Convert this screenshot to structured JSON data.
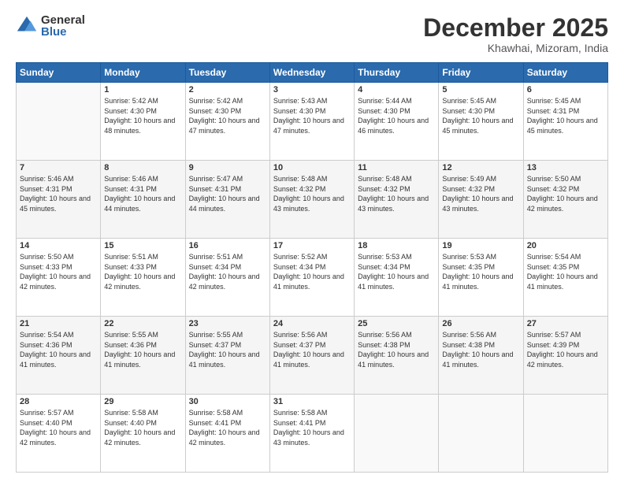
{
  "logo": {
    "general": "General",
    "blue": "Blue"
  },
  "header": {
    "month": "December 2025",
    "location": "Khawhai, Mizoram, India"
  },
  "weekdays": [
    "Sunday",
    "Monday",
    "Tuesday",
    "Wednesday",
    "Thursday",
    "Friday",
    "Saturday"
  ],
  "weeks": [
    [
      {
        "day": "",
        "sunrise": "",
        "sunset": "",
        "daylight": ""
      },
      {
        "day": "1",
        "sunrise": "Sunrise: 5:42 AM",
        "sunset": "Sunset: 4:30 PM",
        "daylight": "Daylight: 10 hours and 48 minutes."
      },
      {
        "day": "2",
        "sunrise": "Sunrise: 5:42 AM",
        "sunset": "Sunset: 4:30 PM",
        "daylight": "Daylight: 10 hours and 47 minutes."
      },
      {
        "day": "3",
        "sunrise": "Sunrise: 5:43 AM",
        "sunset": "Sunset: 4:30 PM",
        "daylight": "Daylight: 10 hours and 47 minutes."
      },
      {
        "day": "4",
        "sunrise": "Sunrise: 5:44 AM",
        "sunset": "Sunset: 4:30 PM",
        "daylight": "Daylight: 10 hours and 46 minutes."
      },
      {
        "day": "5",
        "sunrise": "Sunrise: 5:45 AM",
        "sunset": "Sunset: 4:30 PM",
        "daylight": "Daylight: 10 hours and 45 minutes."
      },
      {
        "day": "6",
        "sunrise": "Sunrise: 5:45 AM",
        "sunset": "Sunset: 4:31 PM",
        "daylight": "Daylight: 10 hours and 45 minutes."
      }
    ],
    [
      {
        "day": "7",
        "sunrise": "Sunrise: 5:46 AM",
        "sunset": "Sunset: 4:31 PM",
        "daylight": "Daylight: 10 hours and 45 minutes."
      },
      {
        "day": "8",
        "sunrise": "Sunrise: 5:46 AM",
        "sunset": "Sunset: 4:31 PM",
        "daylight": "Daylight: 10 hours and 44 minutes."
      },
      {
        "day": "9",
        "sunrise": "Sunrise: 5:47 AM",
        "sunset": "Sunset: 4:31 PM",
        "daylight": "Daylight: 10 hours and 44 minutes."
      },
      {
        "day": "10",
        "sunrise": "Sunrise: 5:48 AM",
        "sunset": "Sunset: 4:32 PM",
        "daylight": "Daylight: 10 hours and 43 minutes."
      },
      {
        "day": "11",
        "sunrise": "Sunrise: 5:48 AM",
        "sunset": "Sunset: 4:32 PM",
        "daylight": "Daylight: 10 hours and 43 minutes."
      },
      {
        "day": "12",
        "sunrise": "Sunrise: 5:49 AM",
        "sunset": "Sunset: 4:32 PM",
        "daylight": "Daylight: 10 hours and 43 minutes."
      },
      {
        "day": "13",
        "sunrise": "Sunrise: 5:50 AM",
        "sunset": "Sunset: 4:32 PM",
        "daylight": "Daylight: 10 hours and 42 minutes."
      }
    ],
    [
      {
        "day": "14",
        "sunrise": "Sunrise: 5:50 AM",
        "sunset": "Sunset: 4:33 PM",
        "daylight": "Daylight: 10 hours and 42 minutes."
      },
      {
        "day": "15",
        "sunrise": "Sunrise: 5:51 AM",
        "sunset": "Sunset: 4:33 PM",
        "daylight": "Daylight: 10 hours and 42 minutes."
      },
      {
        "day": "16",
        "sunrise": "Sunrise: 5:51 AM",
        "sunset": "Sunset: 4:34 PM",
        "daylight": "Daylight: 10 hours and 42 minutes."
      },
      {
        "day": "17",
        "sunrise": "Sunrise: 5:52 AM",
        "sunset": "Sunset: 4:34 PM",
        "daylight": "Daylight: 10 hours and 41 minutes."
      },
      {
        "day": "18",
        "sunrise": "Sunrise: 5:53 AM",
        "sunset": "Sunset: 4:34 PM",
        "daylight": "Daylight: 10 hours and 41 minutes."
      },
      {
        "day": "19",
        "sunrise": "Sunrise: 5:53 AM",
        "sunset": "Sunset: 4:35 PM",
        "daylight": "Daylight: 10 hours and 41 minutes."
      },
      {
        "day": "20",
        "sunrise": "Sunrise: 5:54 AM",
        "sunset": "Sunset: 4:35 PM",
        "daylight": "Daylight: 10 hours and 41 minutes."
      }
    ],
    [
      {
        "day": "21",
        "sunrise": "Sunrise: 5:54 AM",
        "sunset": "Sunset: 4:36 PM",
        "daylight": "Daylight: 10 hours and 41 minutes."
      },
      {
        "day": "22",
        "sunrise": "Sunrise: 5:55 AM",
        "sunset": "Sunset: 4:36 PM",
        "daylight": "Daylight: 10 hours and 41 minutes."
      },
      {
        "day": "23",
        "sunrise": "Sunrise: 5:55 AM",
        "sunset": "Sunset: 4:37 PM",
        "daylight": "Daylight: 10 hours and 41 minutes."
      },
      {
        "day": "24",
        "sunrise": "Sunrise: 5:56 AM",
        "sunset": "Sunset: 4:37 PM",
        "daylight": "Daylight: 10 hours and 41 minutes."
      },
      {
        "day": "25",
        "sunrise": "Sunrise: 5:56 AM",
        "sunset": "Sunset: 4:38 PM",
        "daylight": "Daylight: 10 hours and 41 minutes."
      },
      {
        "day": "26",
        "sunrise": "Sunrise: 5:56 AM",
        "sunset": "Sunset: 4:38 PM",
        "daylight": "Daylight: 10 hours and 41 minutes."
      },
      {
        "day": "27",
        "sunrise": "Sunrise: 5:57 AM",
        "sunset": "Sunset: 4:39 PM",
        "daylight": "Daylight: 10 hours and 42 minutes."
      }
    ],
    [
      {
        "day": "28",
        "sunrise": "Sunrise: 5:57 AM",
        "sunset": "Sunset: 4:40 PM",
        "daylight": "Daylight: 10 hours and 42 minutes."
      },
      {
        "day": "29",
        "sunrise": "Sunrise: 5:58 AM",
        "sunset": "Sunset: 4:40 PM",
        "daylight": "Daylight: 10 hours and 42 minutes."
      },
      {
        "day": "30",
        "sunrise": "Sunrise: 5:58 AM",
        "sunset": "Sunset: 4:41 PM",
        "daylight": "Daylight: 10 hours and 42 minutes."
      },
      {
        "day": "31",
        "sunrise": "Sunrise: 5:58 AM",
        "sunset": "Sunset: 4:41 PM",
        "daylight": "Daylight: 10 hours and 43 minutes."
      },
      {
        "day": "",
        "sunrise": "",
        "sunset": "",
        "daylight": ""
      },
      {
        "day": "",
        "sunrise": "",
        "sunset": "",
        "daylight": ""
      },
      {
        "day": "",
        "sunrise": "",
        "sunset": "",
        "daylight": ""
      }
    ]
  ]
}
